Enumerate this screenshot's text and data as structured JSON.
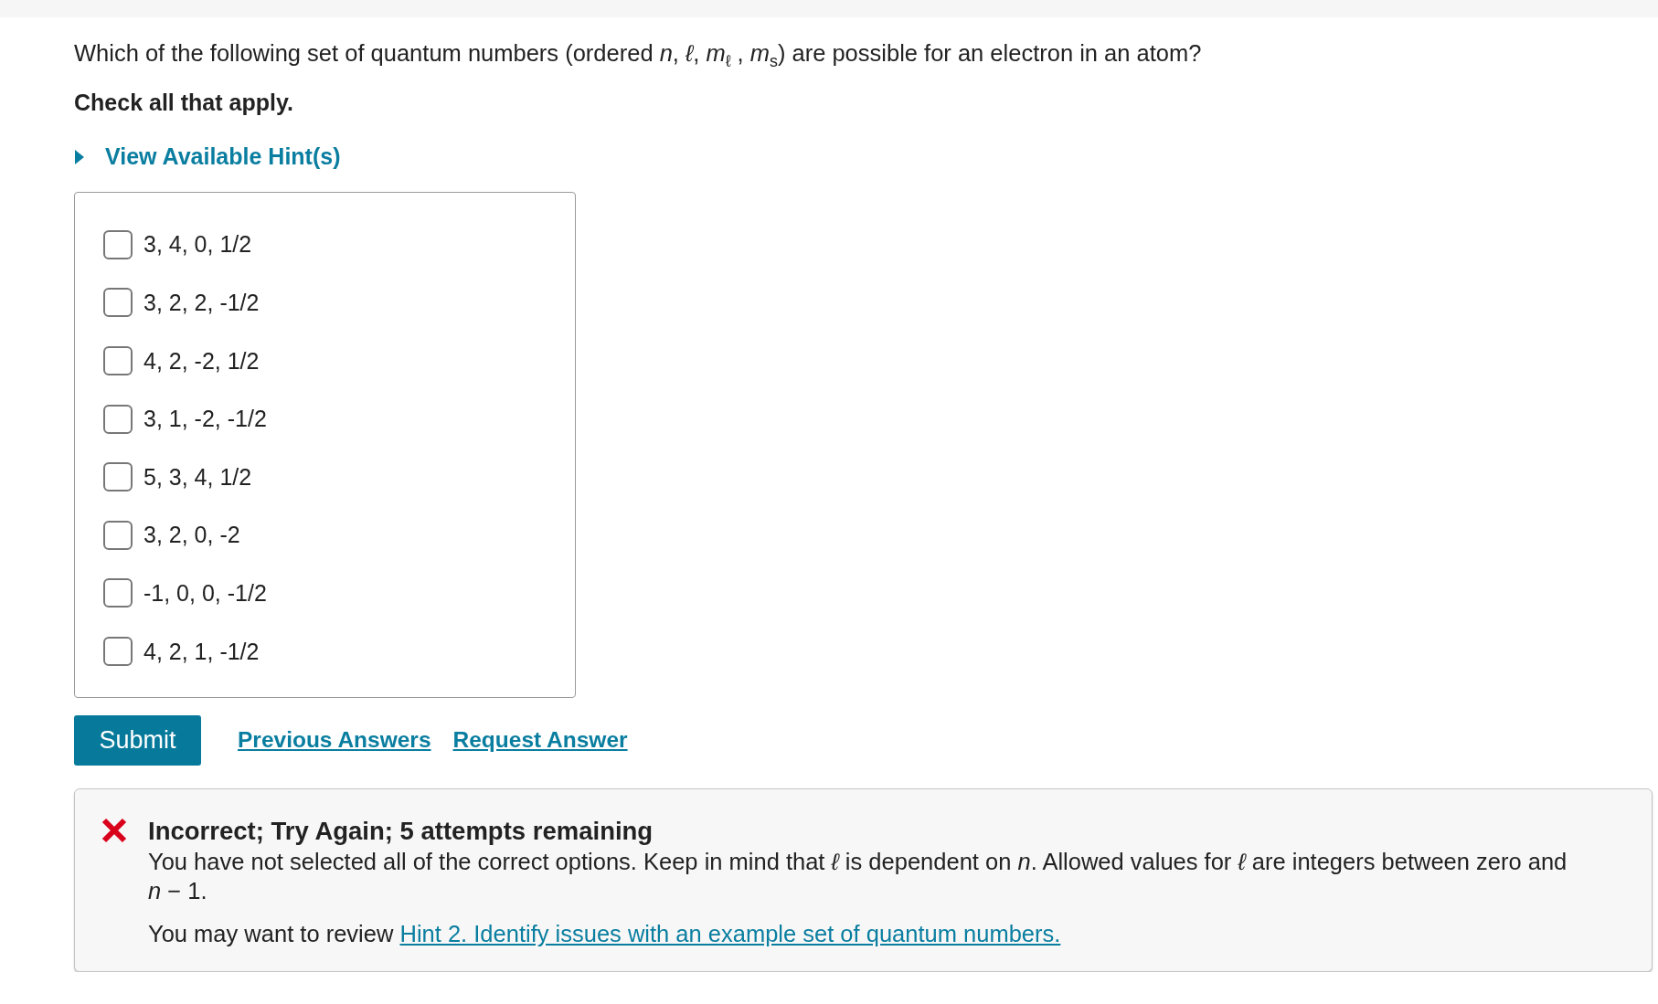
{
  "question": {
    "prompt": "Which of the following set of quantum numbers (ordered *n*, *ℓ*, *m*$_{ℓ}$ , *m*$_{s}$) are possible for an electron in an atom?",
    "instruction": "Check all that apply."
  },
  "hint": {
    "label": "View Available Hint(s)",
    "expanded": false
  },
  "choices": [
    {
      "label": "3, 4, 0, 1/2",
      "checked": false
    },
    {
      "label": "3, 2, 2, -1/2",
      "checked": false
    },
    {
      "label": "4, 2, -2, 1/2",
      "checked": false
    },
    {
      "label": "3, 1, -2, -1/2",
      "checked": false
    },
    {
      "label": "5, 3, 4, 1/2",
      "checked": false
    },
    {
      "label": "3, 2, 0, -2",
      "checked": false
    },
    {
      "label": "-1, 0, 0, -1/2",
      "checked": false
    },
    {
      "label": "4, 2, 1, -1/2",
      "checked": false
    }
  ],
  "actions": {
    "submit": "Submit",
    "links": [
      "Previous Answers",
      "Request Answer"
    ]
  },
  "feedback": {
    "correct": false,
    "title": "Incorrect; Try Again; 5 attempts remaining",
    "message": "You have not selected all of the correct options. Keep in mind that *ℓ* is dependent on *n*. Allowed values for *ℓ* are integers between zero and *n* − 1.",
    "review_text": "You may want to review",
    "review_link": "Hint 2. Identify issues with an example set of quantum numbers."
  }
}
